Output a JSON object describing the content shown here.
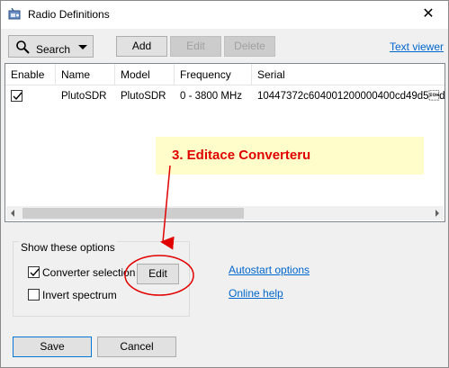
{
  "window": {
    "title": "Radio Definitions",
    "close_symbol": "✕"
  },
  "toolbar": {
    "search_label": "Search",
    "add_label": "Add",
    "edit_label": "Edit",
    "delete_label": "Delete",
    "text_viewer_label": "Text viewer"
  },
  "grid": {
    "columns": [
      "Enable",
      "Name",
      "Model",
      "Frequency",
      "Serial"
    ],
    "rows": [
      {
        "enabled": true,
        "name": "PlutoSDR",
        "model": "PlutoSDR",
        "frequency": "0 - 3800 MHz",
        "serial": "10447372c604001200000400cd49d5\u0001d"
      }
    ]
  },
  "callout": {
    "text": "3. Editace Converteru",
    "color": "#e10000"
  },
  "options": {
    "group_label": "Show these options",
    "converter_selection_label": "Converter selection",
    "converter_selection_checked": true,
    "converter_edit_label": "Edit",
    "invert_spectrum_label": "Invert spectrum",
    "invert_spectrum_checked": false
  },
  "links": {
    "autostart_label": "Autostart options",
    "online_help_label": "Online help"
  },
  "footer": {
    "save_label": "Save",
    "cancel_label": "Cancel"
  },
  "colors": {
    "link": "#0066cc",
    "annotation": "#e10000",
    "callout_bg": "#fffecb"
  }
}
